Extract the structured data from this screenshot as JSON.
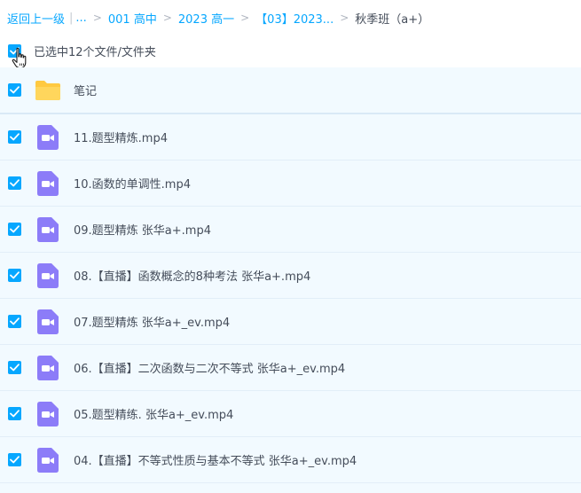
{
  "breadcrumb": {
    "back_label": "返回上一级",
    "pipe": "|",
    "ellipsis": "...",
    "separator": ">",
    "items": [
      "001 高中",
      "2023 高一",
      "【03】2023..."
    ],
    "current": "秋季班（a+）"
  },
  "selection": {
    "label": "已选中12个文件/文件夹"
  },
  "colors": {
    "accent": "#06a7ff",
    "row_selected_bg": "#f2faff",
    "folder": "#ffd152",
    "video": "#8c7cf8"
  },
  "files": [
    {
      "name": "笔记",
      "type": "folder",
      "icon": "folder-icon"
    },
    {
      "name": "11.题型精炼.mp4",
      "type": "video",
      "icon": "video-file-icon"
    },
    {
      "name": "10.函数的单调性.mp4",
      "type": "video",
      "icon": "video-file-icon"
    },
    {
      "name": "09.题型精炼 张华a+.mp4",
      "type": "video",
      "icon": "video-file-icon"
    },
    {
      "name": "08.【直播】函数概念的8种考法 张华a+.mp4",
      "type": "video",
      "icon": "video-file-icon"
    },
    {
      "name": "07.题型精炼 张华a+_ev.mp4",
      "type": "video",
      "icon": "video-file-icon"
    },
    {
      "name": "06.【直播】二次函数与二次不等式 张华a+_ev.mp4",
      "type": "video",
      "icon": "video-file-icon"
    },
    {
      "name": "05.题型精练. 张华a+_ev.mp4",
      "type": "video",
      "icon": "video-file-icon"
    },
    {
      "name": "04.【直播】不等式性质与基本不等式 张华a+_ev.mp4",
      "type": "video",
      "icon": "video-file-icon"
    }
  ]
}
